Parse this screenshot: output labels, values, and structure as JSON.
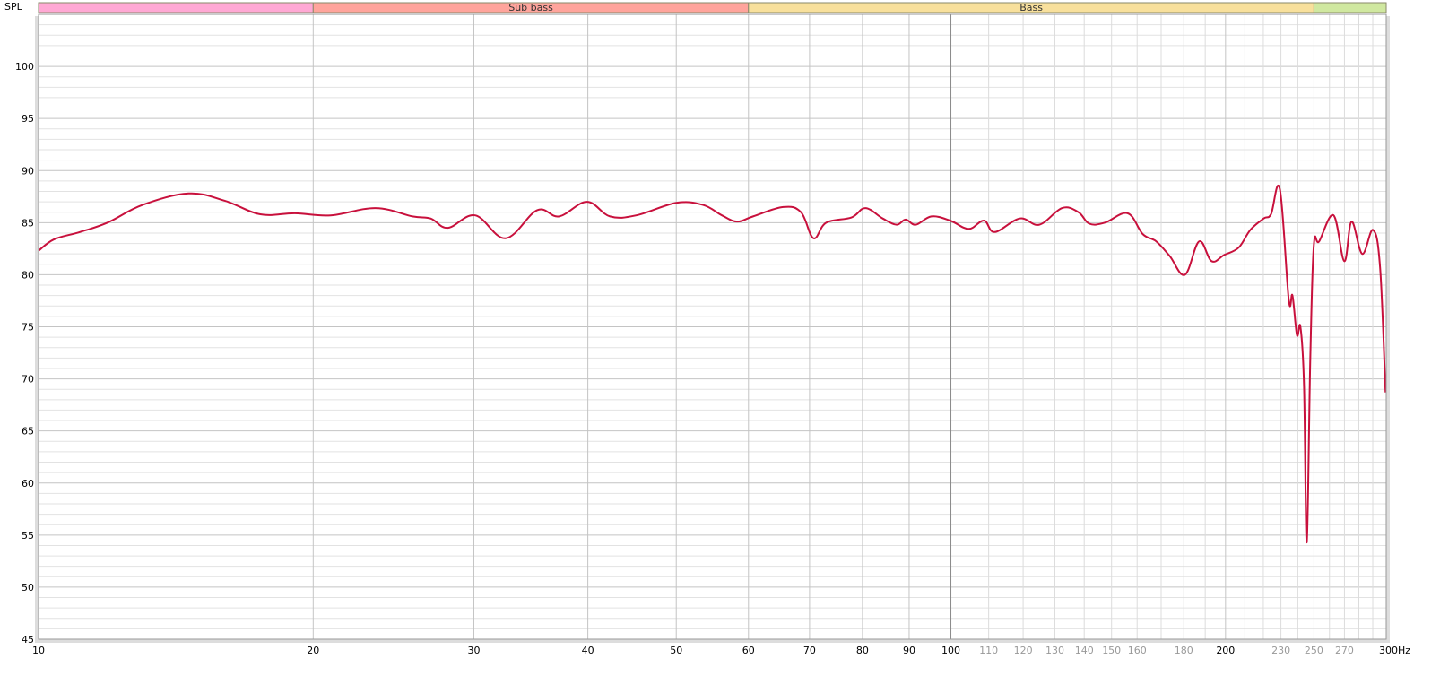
{
  "chart_data": {
    "type": "line",
    "title": "",
    "ylabel": "SPL",
    "xlabel": "Hz",
    "xscale": "log",
    "xlim": [
      10,
      300
    ],
    "ylim": [
      45,
      105
    ],
    "grid": true,
    "y_ticks": [
      45,
      50,
      55,
      60,
      65,
      70,
      75,
      80,
      85,
      90,
      95,
      100
    ],
    "x_ticks": [
      {
        "value": 10,
        "label": "10",
        "major": true
      },
      {
        "value": 20,
        "label": "20",
        "major": true
      },
      {
        "value": 30,
        "label": "30",
        "major": true
      },
      {
        "value": 40,
        "label": "40",
        "major": true
      },
      {
        "value": 50,
        "label": "50",
        "major": true
      },
      {
        "value": 60,
        "label": "60",
        "major": true
      },
      {
        "value": 70,
        "label": "70",
        "major": true
      },
      {
        "value": 80,
        "label": "80",
        "major": true
      },
      {
        "value": 90,
        "label": "90",
        "major": true
      },
      {
        "value": 100,
        "label": "100",
        "major": true
      },
      {
        "value": 110,
        "label": "110",
        "major": false
      },
      {
        "value": 120,
        "label": "120",
        "major": false
      },
      {
        "value": 130,
        "label": "130",
        "major": false
      },
      {
        "value": 140,
        "label": "140",
        "major": false
      },
      {
        "value": 150,
        "label": "150",
        "major": false
      },
      {
        "value": 160,
        "label": "160",
        "major": false
      },
      {
        "value": 180,
        "label": "180",
        "major": false
      },
      {
        "value": 200,
        "label": "200",
        "major": true
      },
      {
        "value": 230,
        "label": "230",
        "major": false
      },
      {
        "value": 250,
        "label": "250",
        "major": false
      },
      {
        "value": 270,
        "label": "270",
        "major": false
      },
      {
        "value": 300,
        "label": "300Hz",
        "major": true
      }
    ],
    "bands": [
      {
        "name": "",
        "from": 10,
        "to": 20,
        "color": "#ffa8d4"
      },
      {
        "name": "Sub bass",
        "from": 20,
        "to": 60,
        "color": "#ffa49c"
      },
      {
        "name": "Bass",
        "from": 60,
        "to": 250,
        "color": "#f8e09c"
      },
      {
        "name": "",
        "from": 250,
        "to": 300,
        "color": "#d0e8a0"
      }
    ],
    "series": [
      {
        "name": "SPL",
        "color": "#c8103c",
        "x": [
          10,
          10.4,
          11.1,
          11.9,
          13.0,
          14.6,
          16.0,
          17.5,
          19.1,
          20.9,
          23.4,
          25.7,
          26.9,
          28.1,
          30.1,
          32.5,
          35.2,
          37.2,
          39.9,
          42.3,
          45.2,
          50.0,
          53.5,
          56.1,
          58.3,
          60.7,
          65.5,
          68.5,
          70.7,
          73.0,
          77.8,
          80.6,
          84.2,
          87.2,
          89.2,
          91.5,
          95.2,
          99.8,
          104.6,
          108.7,
          111.7,
          119,
          125,
          132.4,
          138,
          141.8,
          147.5,
          156.2,
          162.3,
          167.9,
          173.7,
          180.5,
          187.1,
          193.1,
          199.3,
          206.7,
          212.9,
          220.2,
          224.3,
          229.4,
          234.6,
          236.8,
          239.5,
          241.6,
          243.8,
          245.5,
          247.7,
          249.9,
          253.3,
          262.7,
          269.9,
          274.9,
          282.4,
          290.2,
          295.4,
          299.5
        ],
        "y": [
          82.3,
          83.4,
          84.1,
          85.0,
          86.7,
          87.8,
          87.1,
          85.8,
          85.9,
          85.7,
          86.4,
          85.6,
          85.4,
          84.5,
          85.7,
          83.5,
          86.2,
          85.6,
          87.0,
          85.6,
          85.7,
          86.9,
          86.7,
          85.7,
          85.1,
          85.6,
          86.5,
          86.0,
          83.5,
          85.0,
          85.5,
          86.4,
          85.4,
          84.8,
          85.3,
          84.8,
          85.6,
          85.2,
          84.4,
          85.2,
          84.1,
          85.4,
          84.8,
          86.4,
          86.0,
          84.9,
          85.0,
          85.9,
          83.9,
          83.2,
          81.8,
          80.0,
          83.2,
          81.3,
          81.9,
          82.6,
          84.3,
          85.4,
          85.8,
          88.2,
          77.6,
          78.0,
          74.2,
          75.0,
          69.4,
          54.3,
          72.0,
          82.8,
          83.2,
          85.7,
          81.3,
          85.1,
          82.0,
          84.3,
          80.7,
          68.7
        ]
      }
    ]
  }
}
